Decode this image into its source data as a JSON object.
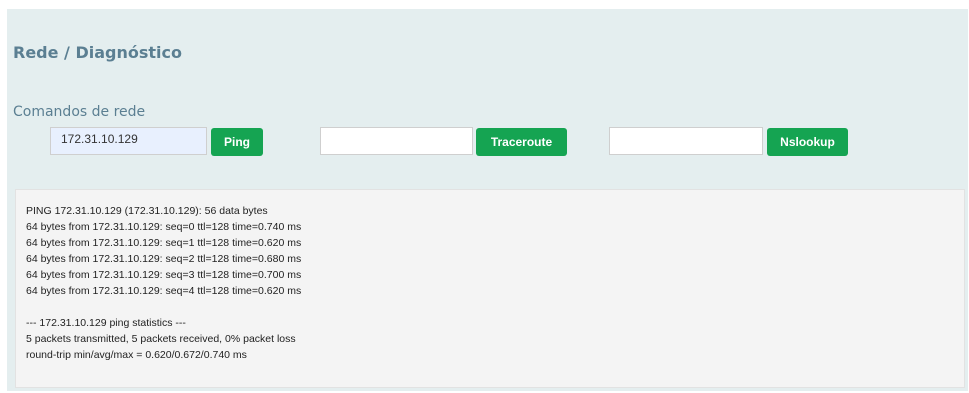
{
  "page_title": "Rede / Diagnóstico",
  "section_label": "Comandos de rede",
  "ping": {
    "value": "172.31.10.129",
    "button_label": "Ping"
  },
  "traceroute": {
    "value": "",
    "button_label": "Traceroute"
  },
  "nslookup": {
    "value": "",
    "button_label": "Nslookup"
  },
  "colors": {
    "panel_bg": "#e4eeef",
    "title": "#5b7f92",
    "button_bg": "#15a452",
    "output_bg": "#f4f4f4"
  },
  "output": {
    "lines": [
      "PING 172.31.10.129 (172.31.10.129): 56 data bytes",
      "64 bytes from 172.31.10.129: seq=0 ttl=128 time=0.740 ms",
      "64 bytes from 172.31.10.129: seq=1 ttl=128 time=0.620 ms",
      "64 bytes from 172.31.10.129: seq=2 ttl=128 time=0.680 ms",
      "64 bytes from 172.31.10.129: seq=3 ttl=128 time=0.700 ms",
      "64 bytes from 172.31.10.129: seq=4 ttl=128 time=0.620 ms",
      "",
      "--- 172.31.10.129 ping statistics ---",
      "5 packets transmitted, 5 packets received, 0% packet loss",
      "round-trip min/avg/max = 0.620/0.672/0.740 ms"
    ]
  }
}
